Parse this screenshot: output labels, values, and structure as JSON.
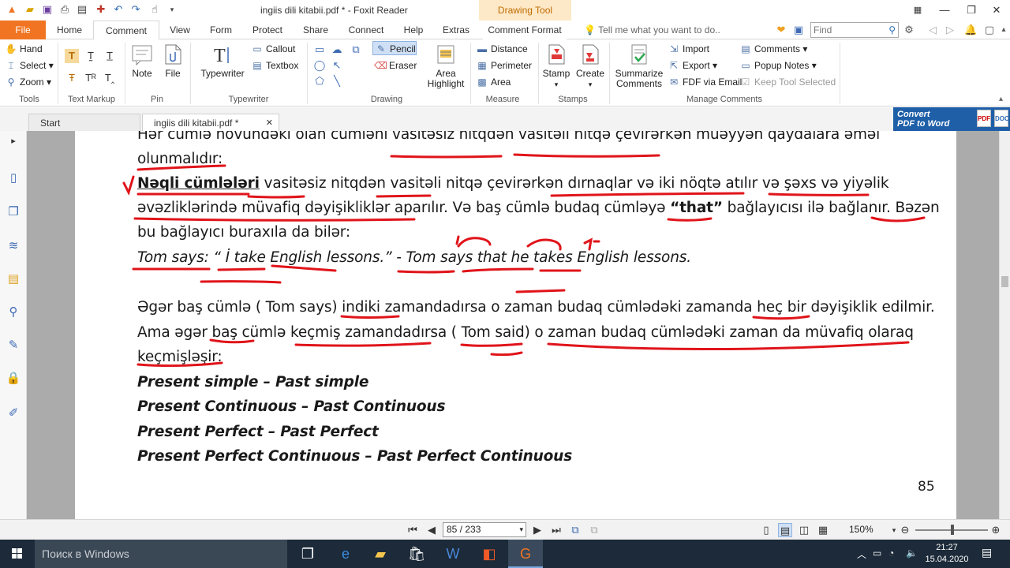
{
  "window": {
    "title": "ingiis dili kitabii.pdf * - Foxit Reader",
    "context_tab": "Drawing Tool"
  },
  "menu_tabs": {
    "file": "File",
    "items": [
      "Home",
      "Comment",
      "View",
      "Form",
      "Protect",
      "Share",
      "Connect",
      "Help",
      "Extras",
      "Comment Format"
    ],
    "active": "Comment",
    "tell_me": "Tell me what you want to do..",
    "find_placeholder": "Find"
  },
  "ribbon": {
    "tools": {
      "hand": "Hand",
      "select": "Select",
      "zoom": "Zoom",
      "label": "Tools"
    },
    "text_markup": {
      "label": "Text Markup"
    },
    "pin": {
      "note": "Note",
      "file": "File",
      "label": "Pin"
    },
    "typewriter": {
      "typewriter": "Typewriter",
      "callout": "Callout",
      "textbox": "Textbox",
      "label": "Typewriter"
    },
    "drawing": {
      "pencil": "Pencil",
      "eraser": "Eraser",
      "area_highlight_1": "Area",
      "area_highlight_2": "Highlight",
      "label": "Drawing"
    },
    "measure": {
      "distance": "Distance",
      "perimeter": "Perimeter",
      "area": "Area",
      "label": "Measure"
    },
    "stamps": {
      "stamp": "Stamp",
      "create": "Create",
      "label": "Stamps"
    },
    "manage": {
      "summarize_1": "Summarize",
      "summarize_2": "Comments",
      "import": "Import",
      "export": "Export",
      "fdf_email": "FDF via Email",
      "comments": "Comments",
      "popup_notes": "Popup Notes",
      "keep_tool": "Keep Tool Selected",
      "label": "Manage Comments"
    }
  },
  "doc_tabs": {
    "start": "Start",
    "current": "ingiis dili kitabii.pdf *"
  },
  "convert_banner": {
    "line1": "Convert",
    "line2": "PDF to Word"
  },
  "document": {
    "lines": [
      "Hər cümlə növündəki olan cümləni vasitəsiz nitqdən vasitəli nitqə çevirərkən müəyyən qaydalara əməl",
      "olunmalıdır:",
      "vasitəsiz nitqdən vasitəli nitqə çevirərkən dırnaqlar və iki nöqtə atılır və şəxs və yiyəlik",
      "əvəzliklərində müvafiq dəyişikliklər aparılır. Və baş cümlə budaq cümləyə",
      "bağlayıcısı ilə bağlanır. Bəzən",
      "bu bağlayıcı buraxıla da bilər:",
      "Tom says: “ İ take English lessons.”   -  Tom says that he takes English lessons.",
      "Əgər baş cümlə ( Tom says) indiki zamandadırsa o zaman budaq cümlədəki zamanda heç bir dəyişiklik edilmir.",
      "Ama əgər baş cümlə keçmiş zamandadırsa ( Tom said) o zaman budaq cümlədəki zaman da müvafiq olaraq",
      "keçmişləşir:",
      "Present simple – Past simple",
      "Present Continuous – Past Continuous",
      "Present Perfect – Past Perfect",
      "Present Perfect Continuous – Past Perfect Continuous"
    ],
    "bold_term": "Nəqli cümlələri",
    "that_word": "“that”",
    "page_number": "85"
  },
  "status": {
    "page_display": "85 / 233",
    "zoom": "150%"
  },
  "taskbar": {
    "search": "Поиск в Windows",
    "time": "21:27",
    "date": "15.04.2020"
  },
  "colors": {
    "accent_orange": "#f07422",
    "annotation_red": "#e0141a",
    "convert_blue": "#1f5fa8",
    "taskbar": "#1c2a39"
  }
}
